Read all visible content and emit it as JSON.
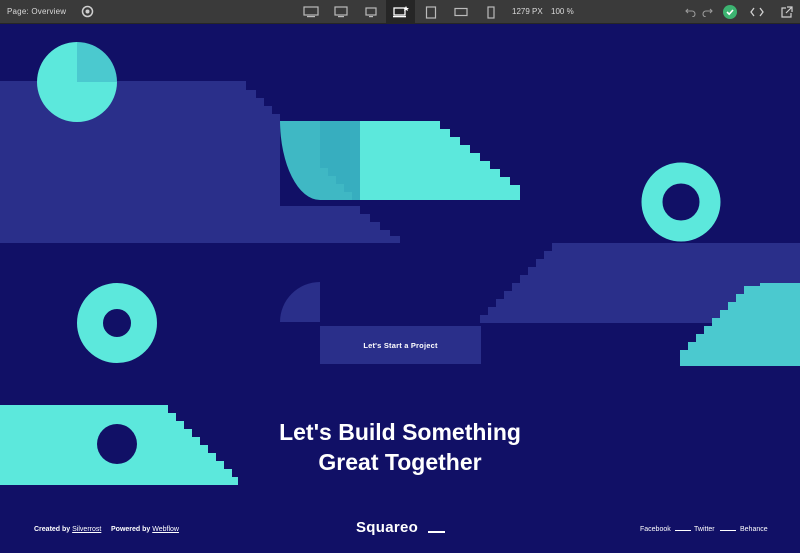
{
  "toolbar": {
    "page_label": "Page: Overview",
    "width_label": "1279 PX",
    "zoom_label": "100 %",
    "icons": [
      "eye-icon",
      "desktop-large-icon",
      "desktop-medium-icon",
      "desktop-small-icon",
      "desktop-base-icon",
      "tablet-icon",
      "mobile-landscape-icon",
      "mobile-portrait-icon",
      "undo-icon",
      "redo-icon",
      "check-icon",
      "code-icon",
      "export-icon"
    ]
  },
  "site": {
    "cta_label": "Let's Start a Project",
    "headline_line1": "Let's Build Something",
    "headline_line2": "Great Together",
    "footer": {
      "created_by_label": "Created by",
      "created_by_name": "Silverrost",
      "powered_by_label": "Powered by",
      "powered_by_name": "Webflow",
      "logo_text": "Squareo",
      "social": [
        "Facebook",
        "Twitter",
        "Behance"
      ]
    }
  },
  "colors": {
    "background": "#111066",
    "shape_dark": "#2a2f8a",
    "teal": "#5ce8dc",
    "teal_muted": "#3fb8c4",
    "toolbar": "#3a3a3a"
  }
}
